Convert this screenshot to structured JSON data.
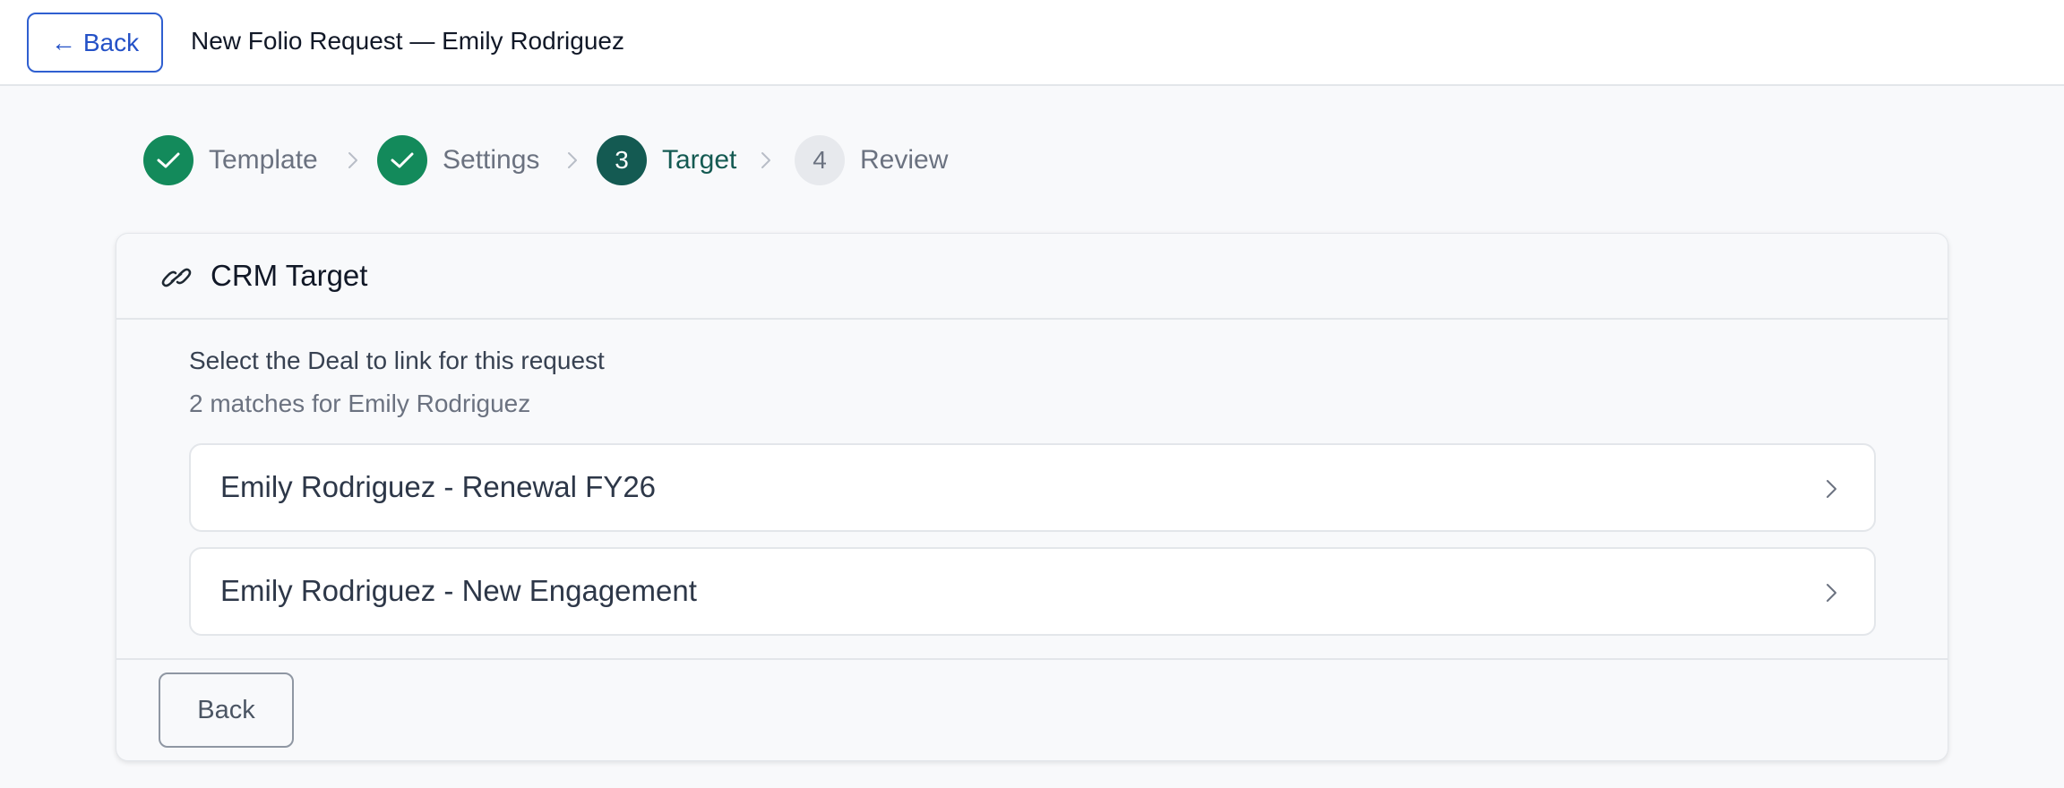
{
  "header": {
    "back_label": "Back",
    "title": "New Folio Request — Emily Rodriguez"
  },
  "stepper": {
    "steps": [
      {
        "label": "Template",
        "state": "done",
        "number": "1"
      },
      {
        "label": "Settings",
        "state": "done",
        "number": "2"
      },
      {
        "label": "Target",
        "state": "current",
        "number": "3"
      },
      {
        "label": "Review",
        "state": "pending",
        "number": "4"
      }
    ]
  },
  "card": {
    "icon": "link-icon",
    "title": "CRM Target",
    "prompt": "Select the Deal to link for this request",
    "matches": "2 matches for Emily Rodriguez",
    "options": [
      {
        "label": "Emily Rodriguez - Renewal FY26"
      },
      {
        "label": "Emily Rodriguez - New Engagement"
      }
    ],
    "footer_back_label": "Back"
  },
  "colors": {
    "done": "#138a5b",
    "current": "#145a52",
    "pending": "#e7e9ed",
    "link_blue": "#2451c7"
  }
}
